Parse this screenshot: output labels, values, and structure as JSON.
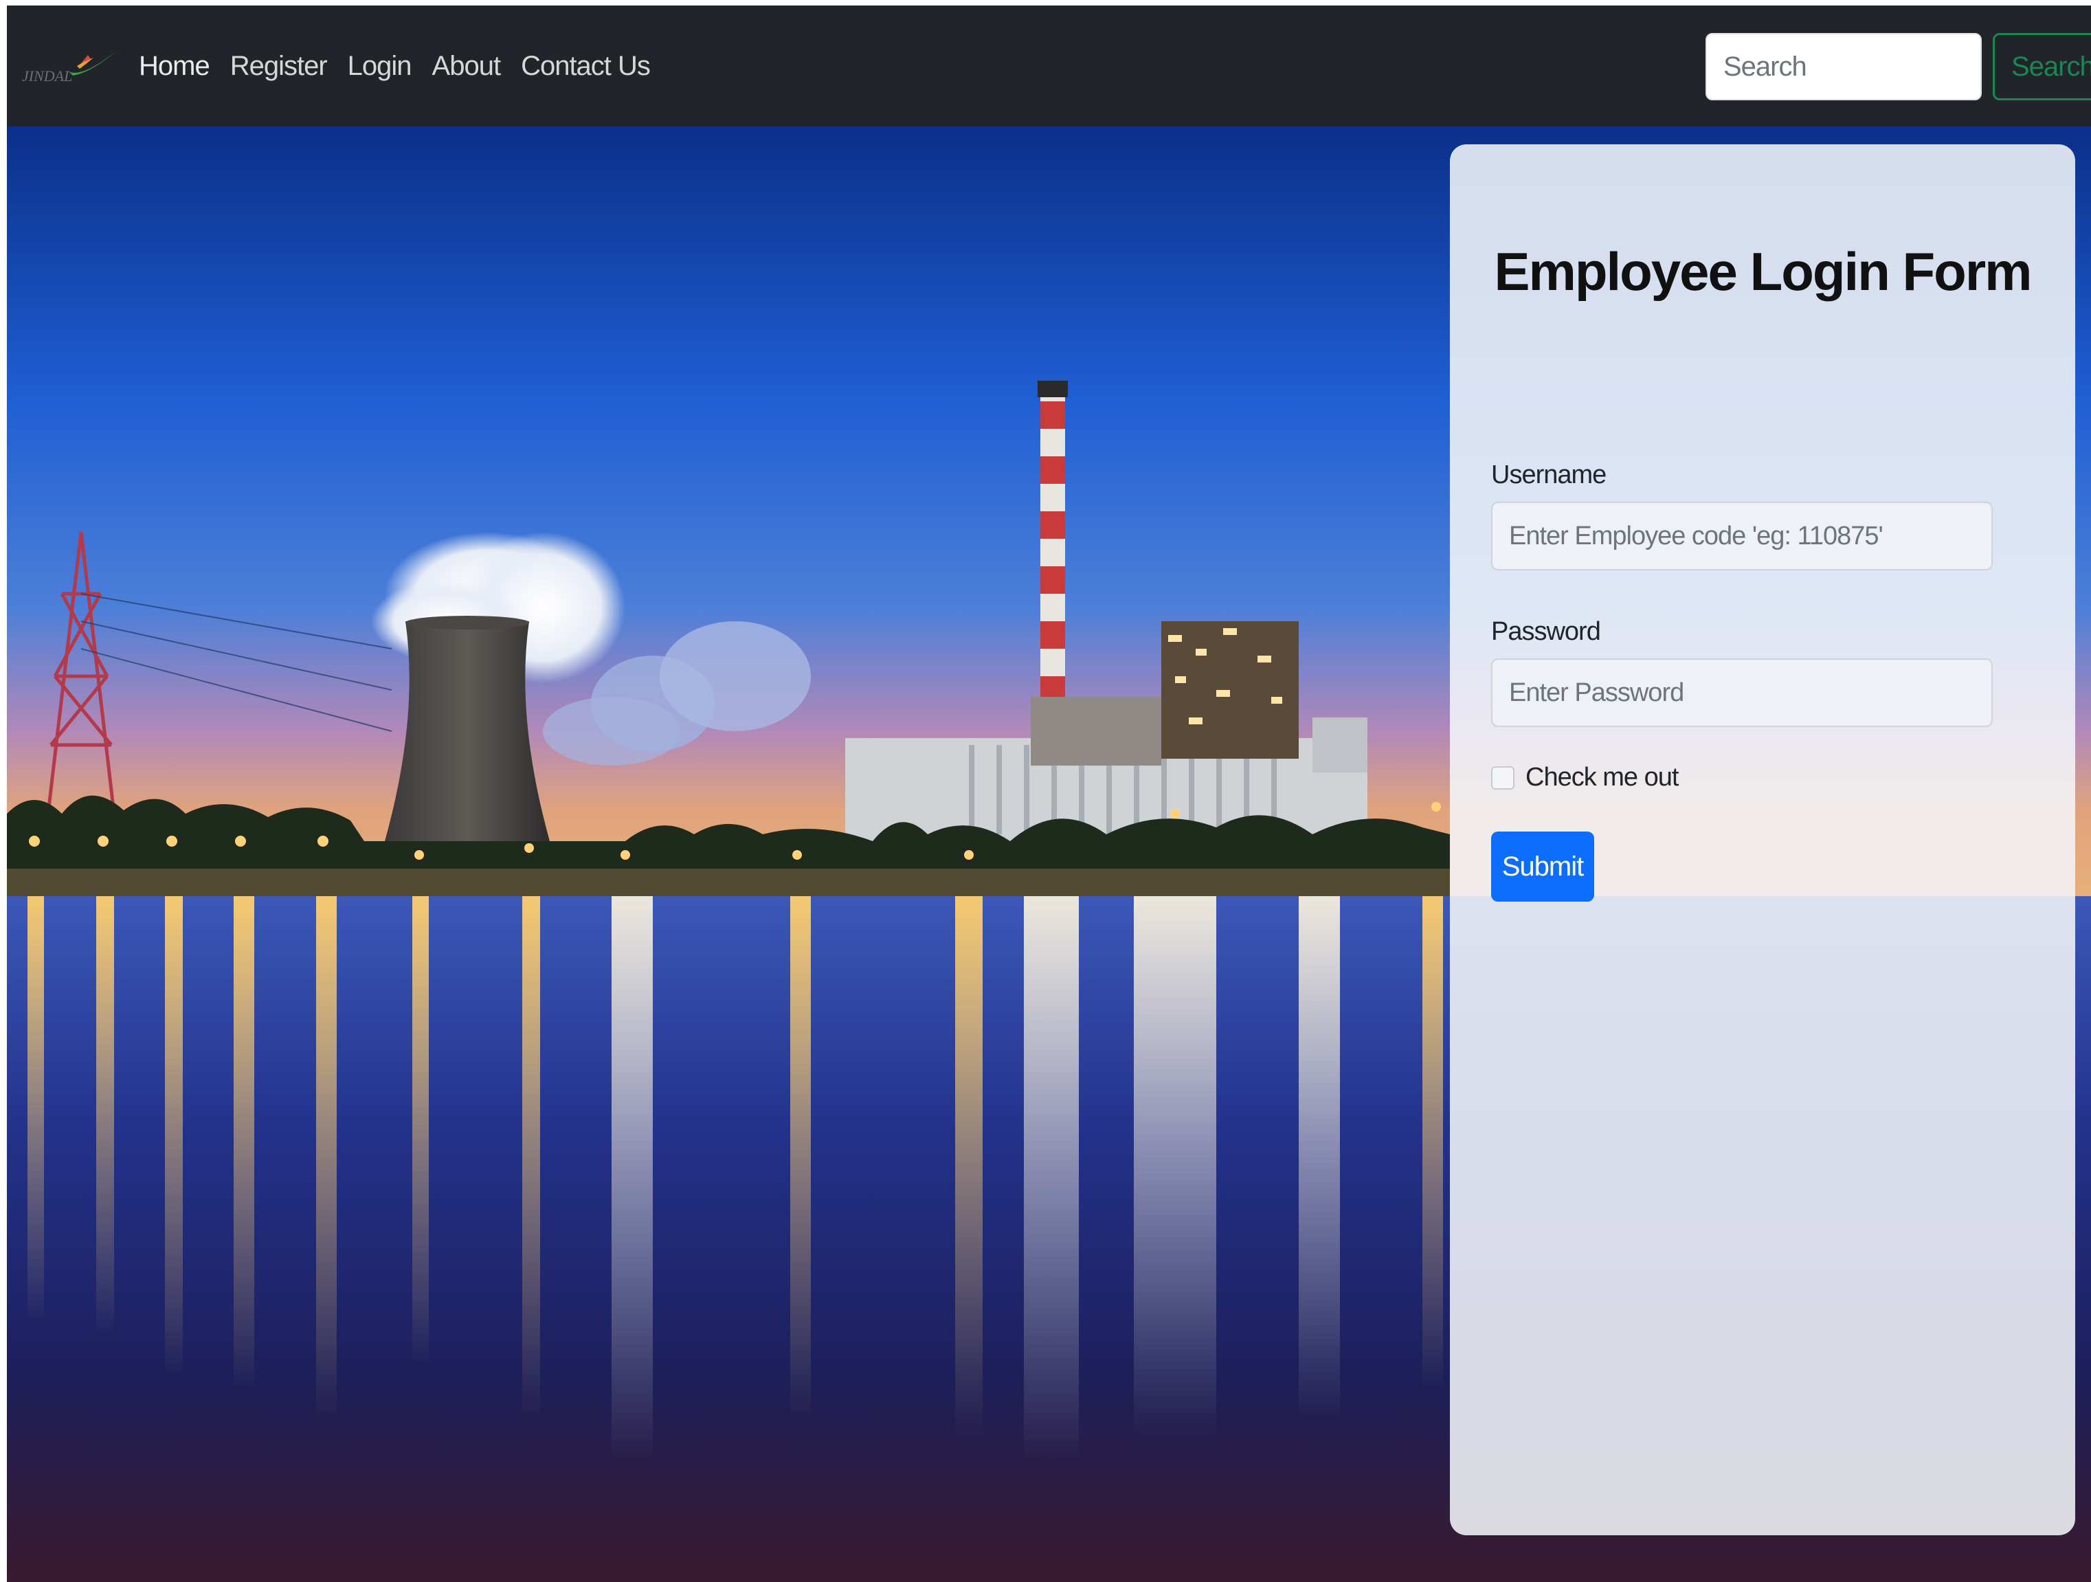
{
  "navbar": {
    "brand_text": "JINDAL",
    "links": [
      {
        "label": "Home"
      },
      {
        "label": "Register"
      },
      {
        "label": "Login"
      },
      {
        "label": "About"
      },
      {
        "label": "Contact Us"
      }
    ],
    "search": {
      "placeholder": "Search",
      "value": "",
      "button_label": "Search"
    }
  },
  "login_form": {
    "title": "Employee Login Form",
    "username": {
      "label": "Username",
      "placeholder": "Enter Employee code 'eg: 110875'",
      "value": ""
    },
    "password": {
      "label": "Password",
      "placeholder": "Enter Password",
      "value": ""
    },
    "remember": {
      "label": "Check me out",
      "checked": false
    },
    "submit_label": "Submit"
  },
  "colors": {
    "navbar_bg": "#212529",
    "search_button": "#198754",
    "submit_button": "#0d6efd"
  },
  "icons": {
    "brand_logo": "jindal-swoosh-logo",
    "hero_image": "power-plant-at-night"
  }
}
